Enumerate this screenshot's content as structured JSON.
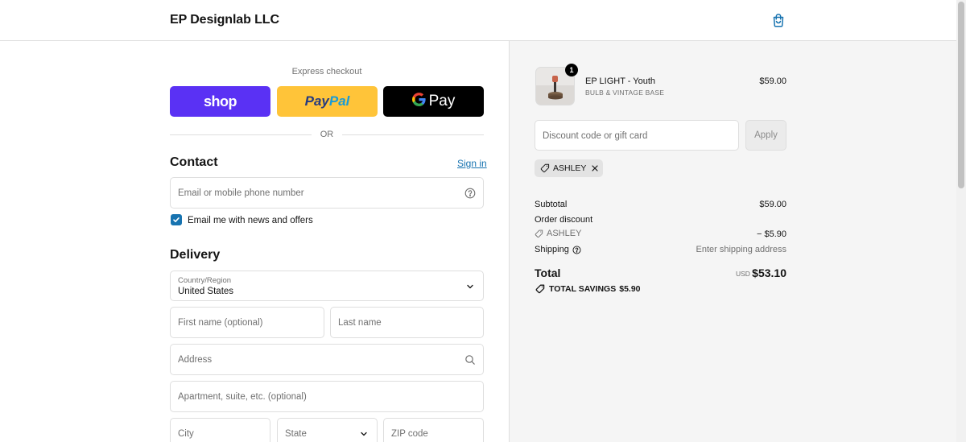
{
  "header": {
    "store_name": "EP Designlab LLC",
    "cart_icon": "shopping-bag-icon"
  },
  "checkout": {
    "express_label": "Express checkout",
    "shop_pay_label": "shop",
    "paypal_label_1": "Pay",
    "paypal_label_2": "Pal",
    "gpay_g": "G",
    "gpay_label": "Pay",
    "or_label": "OR",
    "contact": {
      "title": "Contact",
      "sign_in": "Sign in",
      "email_placeholder": "Email or mobile phone number",
      "newsletter_label": "Email me with news and offers",
      "newsletter_checked": true
    },
    "delivery": {
      "title": "Delivery",
      "country_label": "Country/Region",
      "country_value": "United States",
      "first_name_placeholder": "First name (optional)",
      "last_name_placeholder": "Last name",
      "address_placeholder": "Address",
      "apartment_placeholder": "Apartment, suite, etc. (optional)",
      "city_placeholder": "City",
      "state_placeholder": "State",
      "zip_placeholder": "ZIP code"
    }
  },
  "summary": {
    "product": {
      "quantity": "1",
      "name": "EP LIGHT - Youth",
      "variant": "BULB & VINTAGE BASE",
      "price": "$59.00"
    },
    "discount_placeholder": "Discount code or gift card",
    "apply_label": "Apply",
    "applied_code": "ASHLEY",
    "subtotal_label": "Subtotal",
    "subtotal_value": "$59.00",
    "order_discount_label": "Order discount",
    "discount_code": "ASHLEY",
    "discount_value": "− $5.90",
    "shipping_label": "Shipping",
    "shipping_value": "Enter shipping address",
    "total_label": "Total",
    "total_currency": "USD",
    "total_value": "$53.10",
    "savings_label": "TOTAL SAVINGS",
    "savings_value": "$5.90"
  },
  "colors": {
    "accent": "#1773b0",
    "shop_pay": "#5a31f4",
    "paypal": "#ffc439",
    "summary_bg": "#f5f5f5"
  }
}
